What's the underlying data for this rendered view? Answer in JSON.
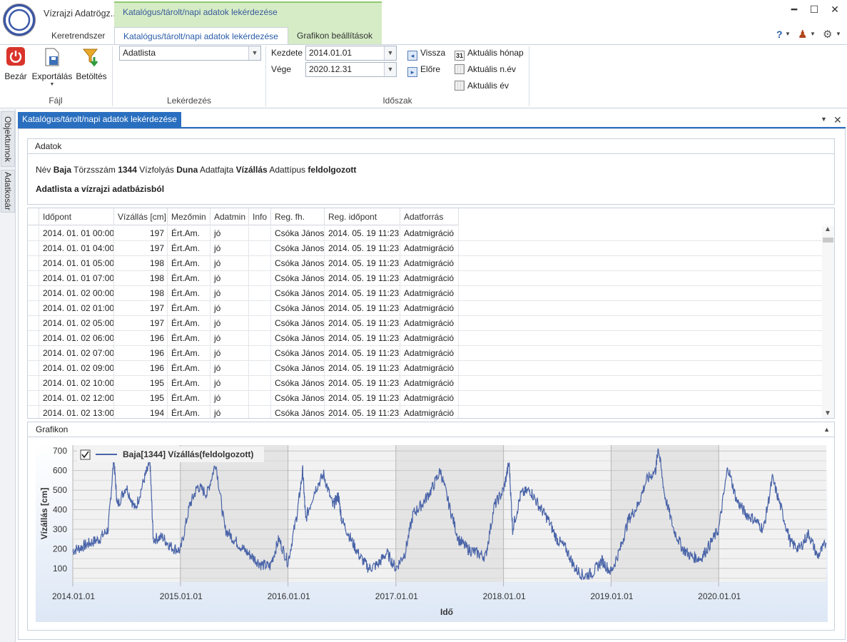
{
  "app": {
    "title": "Vízrajzi Adatrögz..."
  },
  "ribbon_tabs": {
    "context_group": "Katalógus/tárolt/napi adatok lekérdezése",
    "tabs": [
      "Keretrendszer",
      "Katalógus/tárolt/napi adatok lekérdezése",
      "Grafikon beállítások"
    ]
  },
  "window": {
    "minimize": "━",
    "maximize": "☐",
    "close": "✕",
    "help": "?",
    "user": "♟",
    "settings": "⚙"
  },
  "ribbon": {
    "fajl": {
      "label": "Fájl",
      "bezar": "Bezár",
      "export": "Exportálás",
      "betoltes": "Betöltés"
    },
    "lekerdezes": {
      "label": "Lekérdezés",
      "query_value": "Adatlista"
    },
    "idoszak": {
      "label": "Időszak",
      "kezdete_label": "Kezdete",
      "kezdete_value": "2014.01.01",
      "vege_label": "Vége",
      "vege_value": "2020.12.31",
      "vissza": "Vissza",
      "elore": "Előre",
      "aktualis_honap": "Aktuális hónap",
      "aktualis_nev": "Aktuális n.év",
      "aktualis_ev": "Aktuális év",
      "cal_day": "31"
    }
  },
  "side_tabs": [
    "Objektumok",
    "Adatkosár"
  ],
  "doc_tab": {
    "title": "Katalógus/tárolt/napi adatok lekérdezése"
  },
  "adatok": {
    "title": "Adatok",
    "info": {
      "nev_label": "Név",
      "nev": "Baja",
      "torzsszam_label": "Törzsszám",
      "torzsszam": "1344",
      "vizfolyas_label": "Vízfolyás",
      "vizfolyas": "Duna",
      "adatfajta_label": "Adatfajta",
      "adatfajta": "Vízállás",
      "adattipus_label": "Adattípus",
      "adattipus": "feldolgozott"
    },
    "subtitle": "Adatlista a vízrajzi adatbázisból"
  },
  "table": {
    "columns": [
      "Időpont",
      "Vízállás [cm]",
      "Mezőmin",
      "Adatmin",
      "Info",
      "Reg. fh.",
      "Reg. időpont",
      "Adatforrás"
    ],
    "rows": [
      [
        "2014. 01. 01 00:00",
        "197",
        "Ért.Am.",
        "jó",
        "",
        "Csóka János",
        "2014. 05. 19 11:23",
        "Adatmigráció"
      ],
      [
        "2014. 01. 01 04:00",
        "197",
        "Ért.Am.",
        "jó",
        "",
        "Csóka János",
        "2014. 05. 19 11:23",
        "Adatmigráció"
      ],
      [
        "2014. 01. 01 05:00",
        "198",
        "Ért.Am.",
        "jó",
        "",
        "Csóka János",
        "2014. 05. 19 11:23",
        "Adatmigráció"
      ],
      [
        "2014. 01. 01 07:00",
        "198",
        "Ért.Am.",
        "jó",
        "",
        "Csóka János",
        "2014. 05. 19 11:23",
        "Adatmigráció"
      ],
      [
        "2014. 01. 02 00:00",
        "198",
        "Ért.Am.",
        "jó",
        "",
        "Csóka János",
        "2014. 05. 19 11:23",
        "Adatmigráció"
      ],
      [
        "2014. 01. 02 01:00",
        "197",
        "Ért.Am.",
        "jó",
        "",
        "Csóka János",
        "2014. 05. 19 11:23",
        "Adatmigráció"
      ],
      [
        "2014. 01. 02 05:00",
        "197",
        "Ért.Am.",
        "jó",
        "",
        "Csóka János",
        "2014. 05. 19 11:23",
        "Adatmigráció"
      ],
      [
        "2014. 01. 02 06:00",
        "196",
        "Ért.Am.",
        "jó",
        "",
        "Csóka János",
        "2014. 05. 19 11:23",
        "Adatmigráció"
      ],
      [
        "2014. 01. 02 07:00",
        "196",
        "Ért.Am.",
        "jó",
        "",
        "Csóka János",
        "2014. 05. 19 11:23",
        "Adatmigráció"
      ],
      [
        "2014. 01. 02 09:00",
        "196",
        "Ért.Am.",
        "jó",
        "",
        "Csóka János",
        "2014. 05. 19 11:23",
        "Adatmigráció"
      ],
      [
        "2014. 01. 02 10:00",
        "195",
        "Ért.Am.",
        "jó",
        "",
        "Csóka János",
        "2014. 05. 19 11:23",
        "Adatmigráció"
      ],
      [
        "2014. 01. 02 12:00",
        "195",
        "Ért.Am.",
        "jó",
        "",
        "Csóka János",
        "2014. 05. 19 11:23",
        "Adatmigráció"
      ],
      [
        "2014. 01. 02 13:00",
        "194",
        "Ért.Am.",
        "jó",
        "",
        "Csóka János",
        "2014. 05. 19 11:23",
        "Adatmigráció"
      ]
    ]
  },
  "grafikon": {
    "title": "Grafikon"
  },
  "chart_data": {
    "type": "line",
    "xlabel": "Idő",
    "ylabel": "Vízállás [cm]",
    "ylim": [
      30,
      730
    ],
    "yticks": [
      100,
      200,
      300,
      400,
      500,
      600,
      700
    ],
    "xticks": [
      "2014.01.01",
      "2015.01.01",
      "2016.01.01",
      "2017.01.01",
      "2018.01.01",
      "2019.01.01",
      "2020.01.01"
    ],
    "xlim": [
      "2014.01.01",
      "2020.12.31"
    ],
    "legend": "top-left",
    "line_color": "#4a64a8",
    "series": [
      {
        "name": "Baja[1344] Vízállás(feldolgozott)",
        "x": [
          "2014.01.01",
          "2014.02.01",
          "2014.03.01",
          "2014.04.01",
          "2014.05.01",
          "2014.05.20",
          "2014.06.01",
          "2014.07.01",
          "2014.08.01",
          "2014.09.01",
          "2014.09.20",
          "2014.10.01",
          "2014.11.01",
          "2014.12.01",
          "2015.01.01",
          "2015.02.01",
          "2015.03.01",
          "2015.04.01",
          "2015.05.01",
          "2015.06.01",
          "2015.07.01",
          "2015.08.01",
          "2015.09.01",
          "2015.10.01",
          "2015.11.01",
          "2015.12.01",
          "2016.01.01",
          "2016.02.01",
          "2016.02.20",
          "2016.03.01",
          "2016.04.01",
          "2016.05.01",
          "2016.06.01",
          "2016.06.20",
          "2016.07.01",
          "2016.08.01",
          "2016.09.01",
          "2016.10.01",
          "2016.11.01",
          "2016.12.01",
          "2017.01.01",
          "2017.02.01",
          "2017.03.01",
          "2017.04.01",
          "2017.05.01",
          "2017.06.01",
          "2017.07.01",
          "2017.08.01",
          "2017.09.01",
          "2017.10.01",
          "2017.11.01",
          "2017.12.01",
          "2018.01.01",
          "2018.01.20",
          "2018.02.01",
          "2018.03.01",
          "2018.04.01",
          "2018.05.01",
          "2018.06.01",
          "2018.07.01",
          "2018.08.01",
          "2018.09.01",
          "2018.10.01",
          "2018.11.01",
          "2018.12.01",
          "2019.01.01",
          "2019.02.01",
          "2019.03.01",
          "2019.04.01",
          "2019.05.01",
          "2019.06.01",
          "2019.06.10",
          "2019.07.01",
          "2019.08.01",
          "2019.09.01",
          "2019.10.01",
          "2019.11.01",
          "2019.12.01",
          "2020.01.01",
          "2020.02.01",
          "2020.03.01",
          "2020.04.01",
          "2020.05.01",
          "2020.06.01",
          "2020.07.01",
          "2020.08.01",
          "2020.09.01",
          "2020.10.01",
          "2020.11.01",
          "2020.12.01",
          "2020.12.31"
        ],
        "values": [
          190,
          210,
          230,
          250,
          300,
          660,
          420,
          520,
          400,
          560,
          640,
          250,
          260,
          210,
          190,
          420,
          520,
          480,
          640,
          300,
          250,
          200,
          160,
          120,
          110,
          250,
          130,
          380,
          600,
          350,
          500,
          580,
          420,
          470,
          350,
          250,
          160,
          100,
          120,
          180,
          100,
          180,
          380,
          430,
          500,
          600,
          420,
          250,
          200,
          180,
          160,
          420,
          500,
          640,
          300,
          480,
          500,
          420,
          350,
          250,
          200,
          100,
          60,
          80,
          140,
          80,
          200,
          350,
          420,
          550,
          600,
          720,
          480,
          300,
          200,
          160,
          150,
          220,
          300,
          620,
          450,
          380,
          350,
          300,
          560,
          400,
          230,
          200,
          280,
          160,
          230
        ]
      }
    ]
  }
}
